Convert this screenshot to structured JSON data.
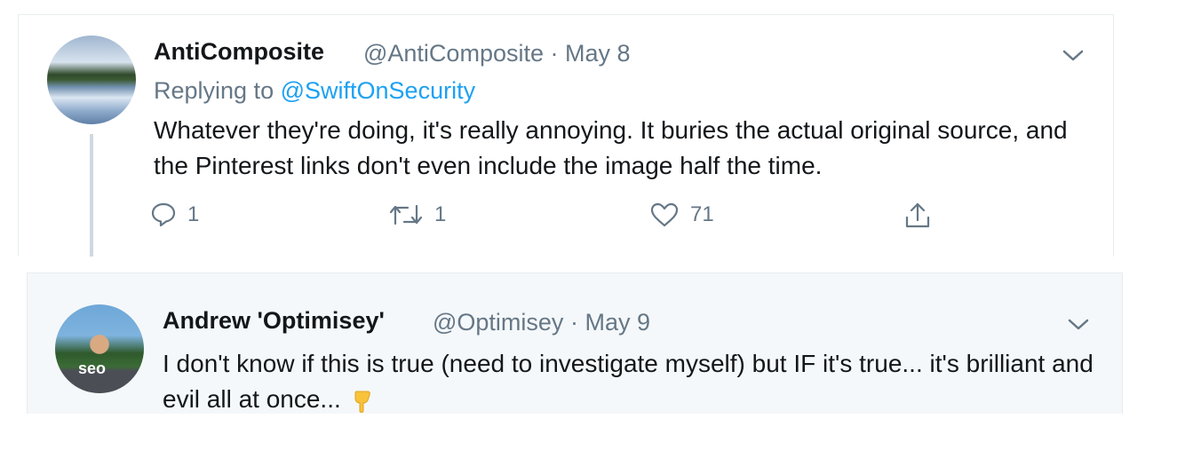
{
  "tweets": [
    {
      "display_name": "AntiComposite",
      "handle": "@AntiComposite",
      "date": "May 8",
      "separator": "·",
      "replying_prefix": "Replying to",
      "replying_handle": "@SwiftOnSecurity",
      "text": "Whatever they're doing, it's really annoying. It buries the actual original source, and the Pinterest links don't even include the image half the time.",
      "actions": {
        "replies": "1",
        "retweets": "1",
        "likes": "71"
      }
    },
    {
      "display_name": "Andrew 'Optimisey'",
      "handle": "@Optimisey",
      "date": "May 9",
      "separator": "·",
      "avatar_badge": "seo",
      "text": "I don't know if this is true (need to investigate myself) but IF it's true... it's brilliant and evil all at once...",
      "emoji": "backhand-index-pointing-down"
    }
  ],
  "colors": {
    "text": "#14171a",
    "muted": "#657786",
    "link": "#1da1f2",
    "border": "#e6ecf0",
    "highlight_bg": "#f5f8fa",
    "emoji": "#f8c23a"
  },
  "icons": {
    "reply": "reply-icon",
    "retweet": "retweet-icon",
    "like": "heart-icon",
    "share": "share-icon",
    "menu": "chevron-down-icon"
  }
}
